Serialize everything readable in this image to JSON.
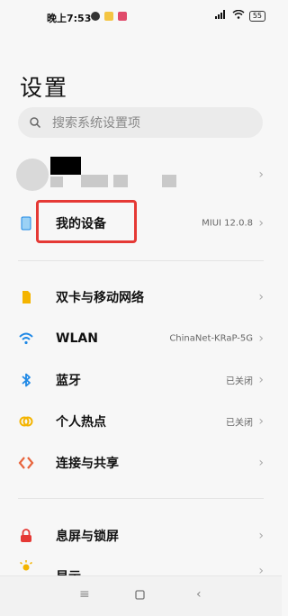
{
  "status": {
    "time": "晚上7:53",
    "battery": "55"
  },
  "page": {
    "title": "设置"
  },
  "search": {
    "placeholder": "搜索系统设置项"
  },
  "rows": [
    {
      "label": "我的设备",
      "value": "MIUI 12.0.8",
      "icon": "device-icon"
    },
    {
      "label": "双卡与移动网络",
      "value": "",
      "icon": "sim-icon"
    },
    {
      "label": "WLAN",
      "value": "ChinaNet-KRaP-5G",
      "icon": "wifi-icon"
    },
    {
      "label": "蓝牙",
      "value": "已关闭",
      "icon": "bluetooth-icon"
    },
    {
      "label": "个人热点",
      "value": "已关闭",
      "icon": "hotspot-icon"
    },
    {
      "label": "连接与共享",
      "value": "",
      "icon": "share-icon"
    },
    {
      "label": "息屏与锁屏",
      "value": "",
      "icon": "lock-icon"
    },
    {
      "label": "显示",
      "value": "",
      "icon": "display-icon"
    }
  ],
  "colors": {
    "highlight": "#e53935",
    "wifi": "#1e88e5",
    "sim": "#f4b400",
    "lock": "#e53935"
  }
}
